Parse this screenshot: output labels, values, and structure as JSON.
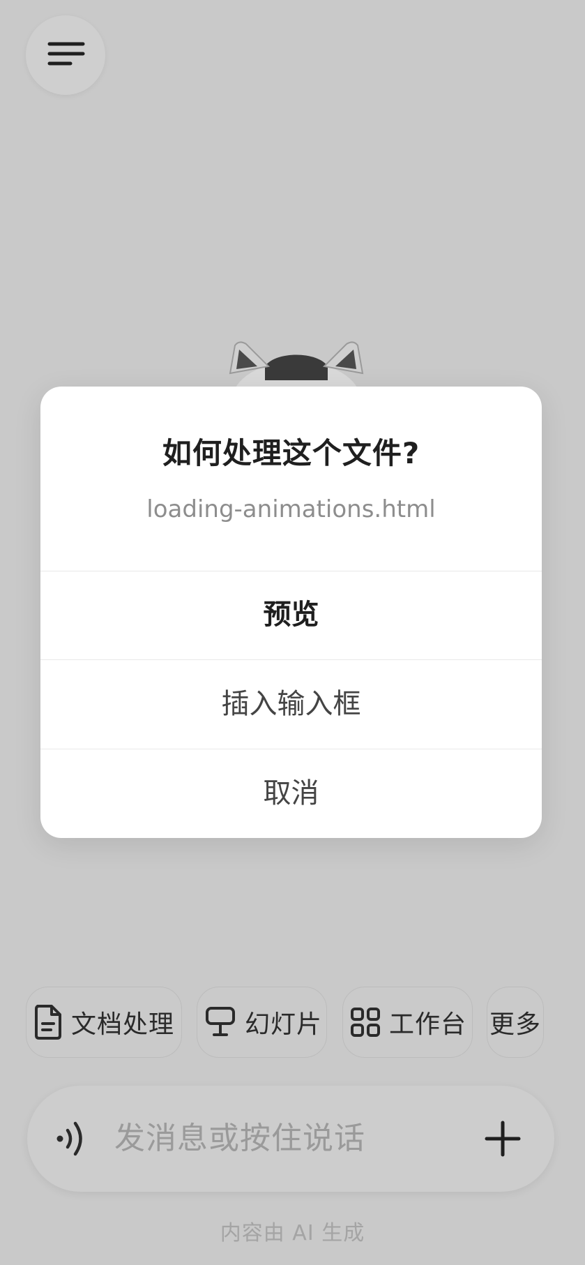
{
  "dialog": {
    "title": "如何处理这个文件?",
    "filename": "loading-animations.html",
    "options": [
      {
        "label": "预览"
      },
      {
        "label": "插入输入框"
      },
      {
        "label": "取消"
      }
    ]
  },
  "quick_actions": [
    {
      "label": "文档处理",
      "icon": "document-icon"
    },
    {
      "label": "幻灯片",
      "icon": "presentation-icon"
    },
    {
      "label": "工作台",
      "icon": "grid-icon"
    },
    {
      "label": "更多",
      "icon": ""
    }
  ],
  "input": {
    "placeholder": "发消息或按住说话"
  },
  "footer": {
    "note": "内容由 AI 生成"
  }
}
